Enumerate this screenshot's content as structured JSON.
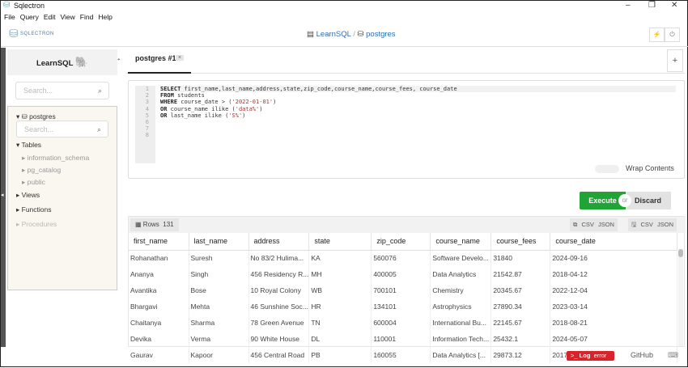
{
  "window": {
    "title": "Sqlectron",
    "minimize": "–",
    "maximize": "❐",
    "close": "✕"
  },
  "menu": [
    "File",
    "Query",
    "Edit",
    "View",
    "Find",
    "Help"
  ],
  "header": {
    "logo": "SQLECTRON",
    "connection": "LearnSQL",
    "separator": "/",
    "database": "postgres"
  },
  "sidebar": {
    "server": "LearnSQL",
    "search_placeholder": "Search...",
    "db": "postgres",
    "db_search_placeholder": "Search...",
    "tables": "Tables",
    "schemas": [
      "information_schema",
      "pg_catalog",
      "public"
    ],
    "views": "Views",
    "functions": "Functions",
    "procedures": "Procedures"
  },
  "tab": {
    "label": "postgres #1",
    "close": "×",
    "add": "+"
  },
  "editor": {
    "line_numbers": [
      "1",
      "2",
      "3",
      "4",
      "5",
      "6",
      "7",
      "8"
    ],
    "lines": [
      [
        {
          "t": "SELECT",
          "c": "kw"
        },
        {
          "t": " first_name,last_name,address,state,zip_code,course_name,course_fees, course_date"
        }
      ],
      [
        {
          "t": "FROM",
          "c": "kw"
        },
        {
          "t": " students"
        }
      ],
      [
        {
          "t": "WHERE",
          "c": "kw"
        },
        {
          "t": " course_date > ("
        },
        {
          "t": "'2022-01-01'",
          "c": "str"
        },
        {
          "t": ")"
        }
      ],
      [
        {
          "t": "OR",
          "c": "kw"
        },
        {
          "t": " course_name ilike ("
        },
        {
          "t": "'data%'",
          "c": "str"
        },
        {
          "t": ")"
        }
      ],
      [
        {
          "t": "OR",
          "c": "kw"
        },
        {
          "t": " last_name ilike ("
        },
        {
          "t": "'S%'",
          "c": "str"
        },
        {
          "t": ")"
        }
      ],
      [],
      [],
      []
    ],
    "wrap_label": "Wrap Contents",
    "wrap_enabled": false
  },
  "actions": {
    "execute": "Execute",
    "or": "or",
    "discard": "Discard"
  },
  "results": {
    "rows_label": "Rows",
    "rows_count": "131",
    "csv": "CSV",
    "json": "JSON",
    "columns": [
      "first_name",
      "last_name",
      "address",
      "state",
      "zip_code",
      "course_name",
      "course_fees",
      "course_date"
    ],
    "rows": [
      [
        "Rohanathan",
        "Suresh",
        "No 83/2 Hulima...",
        "KA",
        "560076",
        "Software Develo...",
        "31840",
        "2024-09-16"
      ],
      [
        "Ananya",
        "Singh",
        "456 Residency R...",
        "MH",
        "400005",
        "Data Analytics",
        "21542.87",
        "2018-04-12"
      ],
      [
        "Avantika",
        "Bose",
        "10 Royal Colony",
        "WB",
        "700101",
        "Chemistry",
        "20345.67",
        "2022-12-04"
      ],
      [
        "Bhargavi",
        "Mehta",
        "46 Sunshine Soc...",
        "HR",
        "134101",
        "Astrophysics",
        "27890.34",
        "2023-03-14"
      ],
      [
        "Chaitanya",
        "Sharma",
        "78 Green Avenue",
        "TN",
        "600004",
        "International Bu...",
        "22145.67",
        "2018-08-21"
      ],
      [
        "Devika",
        "Verma",
        "90 White House",
        "DL",
        "110001",
        "Information Tech...",
        "25432.1",
        "2024-05-07"
      ],
      [
        "Gaurav",
        "Kapoor",
        "456 Central Road",
        "PB",
        "160055",
        "Data Analytics [...",
        "29873.12",
        "2017-11-23"
      ]
    ]
  },
  "footer": {
    "log_prompt": ">_",
    "log": "Log",
    "error": "error",
    "github": "GitHub"
  },
  "colors": {
    "execute": "#21a336",
    "error": "#d9232b",
    "link": "#2a6ebb",
    "sidebar_bg": "#faf7f0"
  }
}
